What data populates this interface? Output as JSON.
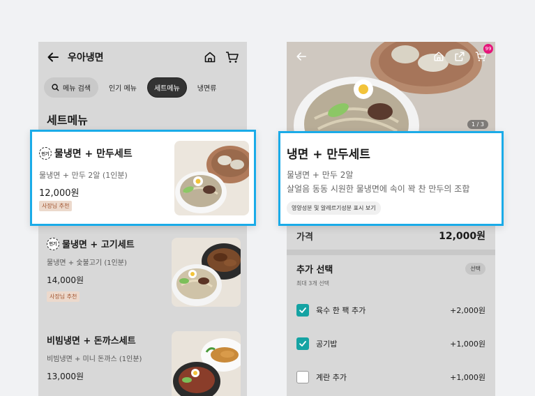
{
  "left": {
    "header": {
      "title": "우아냉면"
    },
    "tabs": [
      {
        "label": "메뉴 검색"
      },
      {
        "label": "인기 메뉴"
      },
      {
        "label": "세트메뉴"
      },
      {
        "label": "냉면류"
      }
    ],
    "section_title": "세트메뉴",
    "items": [
      {
        "popular_badge": "인기",
        "name": "물냉면 + 만두세트",
        "desc": "물냉면 + 만두 2알 (1인분)",
        "price": "12,000원",
        "tag": "사장님 추천"
      },
      {
        "popular_badge": "인기",
        "name": "물냉면 + 고기세트",
        "desc": "물냉면 + 숯불고기 (1인분)",
        "price": "14,000원",
        "tag": "사장님 추천"
      },
      {
        "name": "비빔냉면 + 돈까스세트",
        "desc": "비빔냉면 + 미니 돈까스 (1인분)",
        "price": "13,000원"
      }
    ]
  },
  "right": {
    "cart_count": "99",
    "image_counter": "1 / 3",
    "title": "냉면 + 만두세트",
    "desc_line1": "물냉면 + 만두 2알",
    "desc_line2": "살얼음 동동 시원한 물냉면에 속이 꽉 찬 만두의 조합",
    "nutrition_button": "영양성분 및 알레르기성분 표시 보기",
    "price_label": "가격",
    "price_value": "12,000원",
    "options": {
      "title": "추가 선택",
      "subtitle": "최대 3개 선택",
      "badge": "선택",
      "items": [
        {
          "name": "육수 한 팩 추가",
          "price": "+2,000원",
          "checked": true
        },
        {
          "name": "공기밥",
          "price": "+1,000원",
          "checked": true
        },
        {
          "name": "계란 추가",
          "price": "+1,000원",
          "checked": false
        }
      ]
    }
  },
  "colors": {
    "accent_teal": "#15a3a3",
    "highlight_border": "#1aabe8",
    "cart_badge": "#e5157a"
  }
}
